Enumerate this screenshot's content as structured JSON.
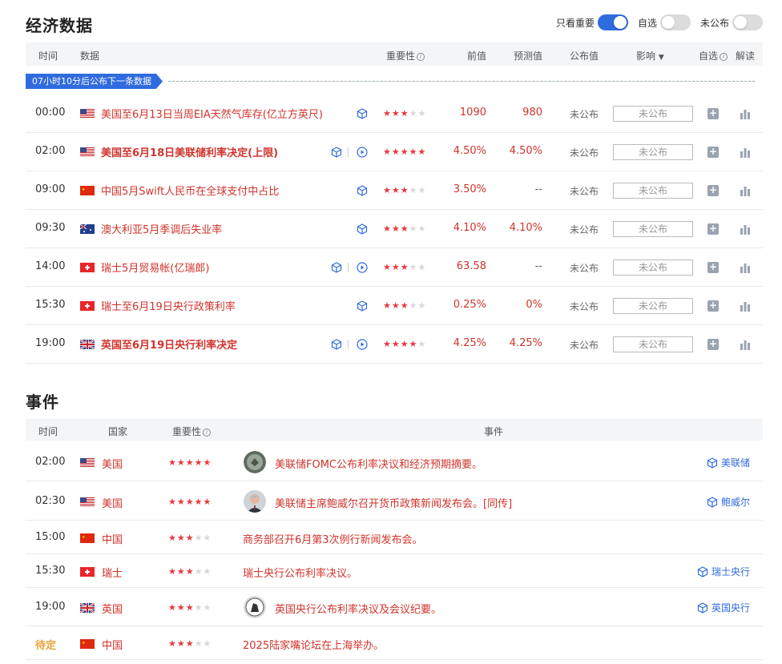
{
  "econ": {
    "title": "经济数据",
    "toggles": [
      {
        "label": "只看重要",
        "on": true
      },
      {
        "label": "自选",
        "on": false
      },
      {
        "label": "未公布",
        "on": false
      }
    ],
    "headers": {
      "time": "时间",
      "data": "数据",
      "importance": "重要性",
      "prev": "前值",
      "forecast": "预测值",
      "published": "公布值",
      "impact": "影响",
      "watch": "自选",
      "interpret": "解读"
    },
    "countdown": "07小时10分后公布下一条数据",
    "rows": [
      {
        "time": "00:00",
        "country": "us",
        "title": "美国至6月13日当周EIA天然气库存(亿立方英尺)",
        "bold": false,
        "video": false,
        "stars": 3,
        "prev": "1090",
        "forecast": "980",
        "published": "未公布",
        "impact": "未公布"
      },
      {
        "time": "02:00",
        "country": "us",
        "title": "美国至6月18日美联储利率决定(上限)",
        "bold": true,
        "video": true,
        "stars": 5,
        "prev": "4.50%",
        "forecast": "4.50%",
        "published": "未公布",
        "impact": "未公布"
      },
      {
        "time": "09:00",
        "country": "cn",
        "title": "中国5月Swift人民币在全球支付中占比",
        "bold": false,
        "video": false,
        "stars": 3,
        "prev": "3.50%",
        "forecast": "--",
        "published": "未公布",
        "impact": "未公布"
      },
      {
        "time": "09:30",
        "country": "au",
        "title": "澳大利亚5月季调后失业率",
        "bold": false,
        "video": false,
        "stars": 3,
        "prev": "4.10%",
        "forecast": "4.10%",
        "published": "未公布",
        "impact": "未公布"
      },
      {
        "time": "14:00",
        "country": "ch",
        "title": "瑞士5月贸易帐(亿瑞郎)",
        "bold": false,
        "video": true,
        "stars": 3,
        "prev": "63.58",
        "forecast": "--",
        "published": "未公布",
        "impact": "未公布"
      },
      {
        "time": "15:30",
        "country": "ch",
        "title": "瑞士至6月19日央行政策利率",
        "bold": false,
        "video": false,
        "stars": 3,
        "prev": "0.25%",
        "forecast": "0%",
        "published": "未公布",
        "impact": "未公布"
      },
      {
        "time": "19:00",
        "country": "uk",
        "title": "英国至6月19日央行利率决定",
        "bold": true,
        "video": true,
        "stars": 4,
        "prev": "4.25%",
        "forecast": "4.25%",
        "published": "未公布",
        "impact": "未公布"
      }
    ]
  },
  "events": {
    "title": "事件",
    "headers": {
      "time": "时间",
      "country": "国家",
      "importance": "重要性",
      "event": "事件"
    },
    "rows": [
      {
        "time": "02:00",
        "pending": false,
        "country": "us",
        "country_name": "美国",
        "stars": 5,
        "avatar": "fed-seal",
        "text": "美联储FOMC公布利率决议和经济预期摘要。",
        "tag": "美联储"
      },
      {
        "time": "02:30",
        "pending": false,
        "country": "us",
        "country_name": "美国",
        "stars": 5,
        "avatar": "powell",
        "text": "美联储主席鲍威尔召开货币政策新闻发布会。[同传]",
        "tag": "鲍威尔"
      },
      {
        "time": "15:00",
        "pending": false,
        "country": "cn",
        "country_name": "中国",
        "stars": 3,
        "avatar": "",
        "text": "商务部召开6月第3次例行新闻发布会。",
        "tag": ""
      },
      {
        "time": "15:30",
        "pending": false,
        "country": "ch",
        "country_name": "瑞士",
        "stars": 3,
        "avatar": "",
        "text": "瑞士央行公布利率决议。",
        "tag": "瑞士央行"
      },
      {
        "time": "19:00",
        "pending": false,
        "country": "uk",
        "country_name": "英国",
        "stars": 3,
        "avatar": "boe-seal",
        "text": "英国央行公布利率决议及会议纪要。",
        "tag": "英国央行"
      },
      {
        "time": "待定",
        "pending": true,
        "country": "cn",
        "country_name": "中国",
        "stars": 3,
        "avatar": "",
        "text": "2025陆家嘴论坛在上海举办。",
        "tag": ""
      }
    ]
  },
  "colors": {
    "accent": "#2f6bde",
    "red": "#d0342c",
    "star": "#e8383d",
    "pending": "#e8a33b"
  }
}
